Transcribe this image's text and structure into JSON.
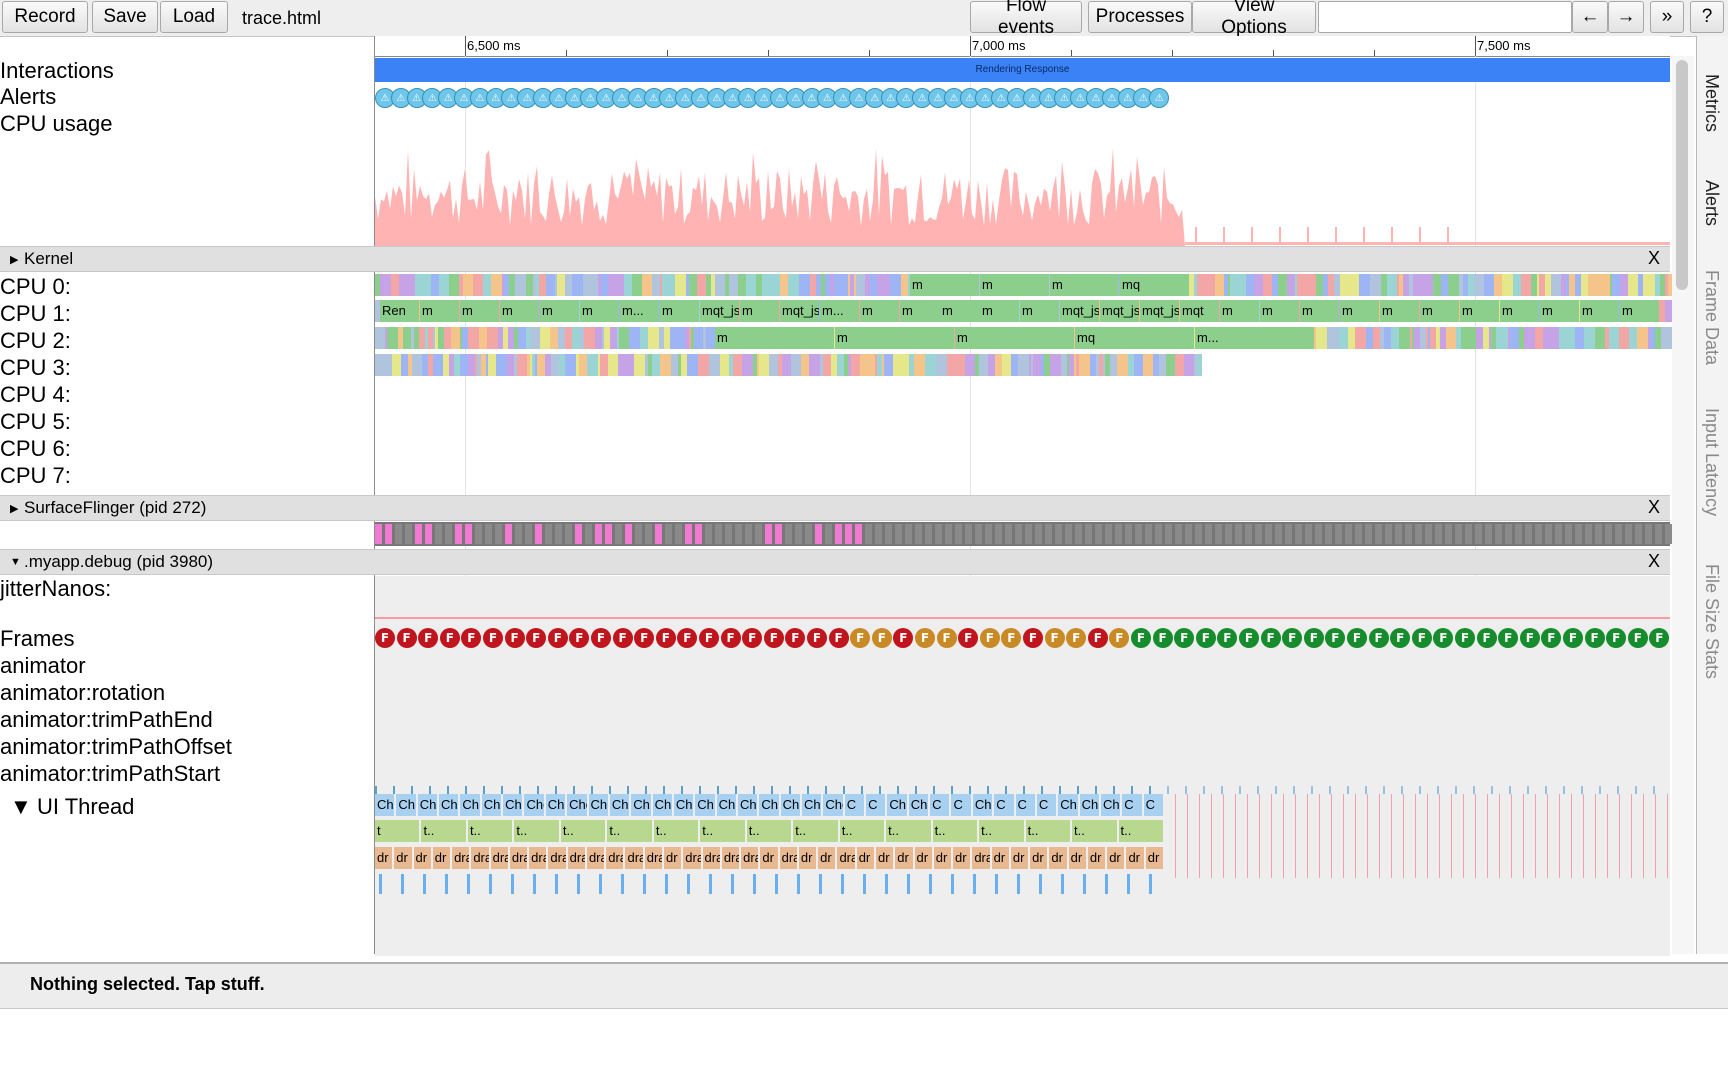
{
  "toolbar": {
    "record": "Record",
    "save": "Save",
    "load": "Load",
    "filename": "trace.html",
    "flow_events": "Flow events",
    "processes": "Processes",
    "view_options": "View Options",
    "prev": "←",
    "next": "→",
    "more": "»",
    "help": "?"
  },
  "ruler": {
    "ticks": [
      "6,500 ms",
      "7,000 ms",
      "7,500 ms"
    ]
  },
  "interactions": {
    "label": "Interactions",
    "bar_text": "Rendering Response",
    "bar_color": "#3b82f6"
  },
  "alerts": {
    "label": "Alerts",
    "glyph": "⚠"
  },
  "cpu_usage": {
    "label": "CPU usage",
    "color": "#ffb3b3"
  },
  "kernel": {
    "header": "Kernel",
    "close": "X",
    "cpus": [
      "CPU 0:",
      "CPU 1:",
      "CPU 2:",
      "CPU 3:",
      "CPU 4:",
      "CPU 5:",
      "CPU 6:",
      "CPU 7:"
    ]
  },
  "surfaceflinger": {
    "header": "SurfaceFlinger (pid 272)",
    "close": "X"
  },
  "myapp": {
    "header": ".myapp.debug (pid 3980)",
    "close": "X",
    "tracks": [
      "jitterNanos:",
      "Frames",
      "animator",
      "animator:rotation",
      "animator:trimPathEnd",
      "animator:trimPathOffset",
      "animator:trimPathStart"
    ],
    "ui_thread": "UI Thread",
    "frame_glyph": "F",
    "frame_colors": {
      "bad": "#c0151c",
      "warn": "#c98a26",
      "good": "#178c2c"
    }
  },
  "cpu_slices": {
    "cpu0": [
      "m",
      "m",
      "m",
      "mq"
    ],
    "cpu1": [
      "Ren",
      "m",
      "m",
      "m",
      "m",
      "m",
      "m...",
      "m",
      "mqt_js",
      "m",
      "mqt_js",
      "m...",
      "m",
      "m",
      "m",
      "m",
      "m",
      "mqt_js",
      "mqt_js",
      "mqt_js",
      "mqt",
      "m",
      "m",
      "m",
      "m",
      "m",
      "m",
      "m",
      "m",
      "m",
      "m",
      "m"
    ],
    "cpu2": [
      "m",
      "m",
      "m",
      "mq",
      "m..."
    ]
  },
  "ui_slices": {
    "row1": [
      "Ch",
      "Ch",
      "Ch",
      "Ch",
      "Ch",
      "Ch",
      "Ch",
      "Cho",
      "Ch",
      "Cho",
      "Ch",
      "Ch",
      "Ch",
      "Ch",
      "Cho",
      "Ch",
      "Ch",
      "Ch",
      "Ch",
      "Ch",
      "Ch",
      "Cho",
      "C",
      "C",
      "Ch",
      "Ch",
      "C",
      "C",
      "Ch",
      "C",
      "C",
      "C",
      "Ch",
      "Ch",
      "Ch",
      "C",
      "C"
    ],
    "row2": [
      "t",
      "t..",
      "t..",
      "t..",
      "t..",
      "t..",
      "t..",
      "t..",
      "t..",
      "t..",
      "t..",
      "t..",
      "t..",
      "t..",
      "t..",
      "t..",
      "t.."
    ],
    "row3": [
      "dr",
      "dr",
      "dr",
      "dr",
      "dra",
      "dra",
      "dra",
      "dra",
      "dra",
      "dra",
      "dra",
      "dra",
      "dra",
      "dra",
      "dra",
      "dr",
      "dra",
      "dra",
      "dra",
      "dra",
      "dr",
      "dra",
      "dr",
      "dr",
      "dra",
      "dr",
      "dr",
      "dr",
      "dr",
      "dr",
      "dr",
      "dra",
      "dr",
      "dr",
      "dr",
      "dr",
      "dr",
      "dr",
      "dr",
      "dr",
      "dr"
    ]
  },
  "side_tabs": [
    "Metrics",
    "Alerts",
    "Frame Data",
    "Input Latency",
    "File Size Stats"
  ],
  "bottom": {
    "message": "Nothing selected. Tap stuff."
  }
}
